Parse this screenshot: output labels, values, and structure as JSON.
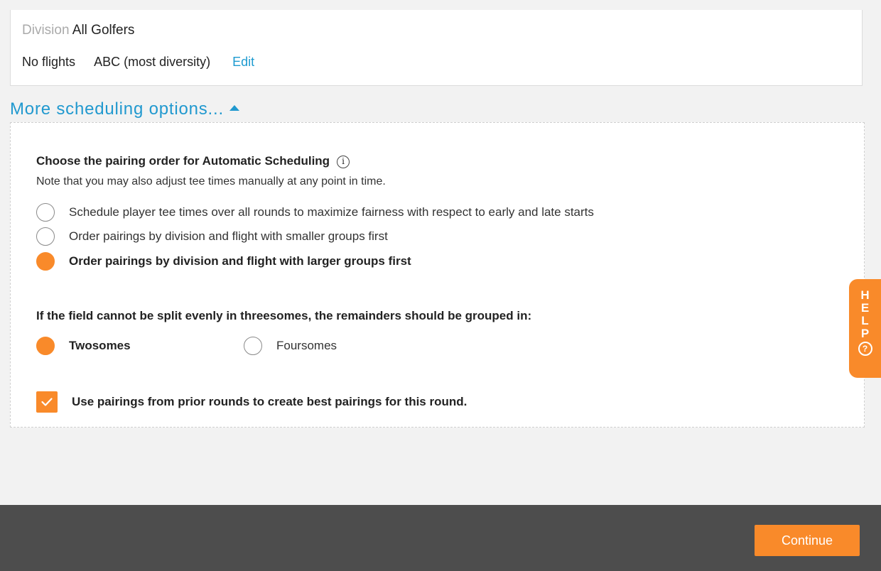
{
  "division": {
    "label": "Division",
    "value": "All Golfers",
    "flights": "No flights",
    "order": "ABC (most diversity)",
    "edit_label": "Edit"
  },
  "more_options": {
    "label": "More scheduling options...",
    "caret_icon": "caret-up-icon"
  },
  "pairing_order": {
    "title": "Choose the pairing order for Automatic Scheduling",
    "info_icon": "info-icon",
    "info_glyph": "i",
    "note": "Note that you may also adjust tee times manually at any point in time.",
    "options": [
      {
        "label": "Schedule player tee times over all rounds to maximize fairness with respect to early and late starts",
        "selected": false
      },
      {
        "label": "Order pairings by division and flight with smaller groups first",
        "selected": false
      },
      {
        "label": "Order pairings by division and flight with larger groups first",
        "selected": true
      }
    ]
  },
  "remainders": {
    "title": "If the field cannot be split evenly in threesomes, the remainders should be grouped in:",
    "options": [
      {
        "label": "Twosomes",
        "selected": true
      },
      {
        "label": "Foursomes",
        "selected": false
      }
    ]
  },
  "prior_rounds": {
    "label": "Use pairings from prior rounds to create best pairings for this round.",
    "checked": true
  },
  "help_tab": {
    "letters": [
      "H",
      "E",
      "L",
      "P"
    ],
    "icon": "question-circle-icon",
    "icon_glyph": "?"
  },
  "footer": {
    "continue_label": "Continue"
  },
  "colors": {
    "accent": "#f98a2a",
    "link": "#2199cf",
    "footer_bg": "#4d4d4d"
  }
}
